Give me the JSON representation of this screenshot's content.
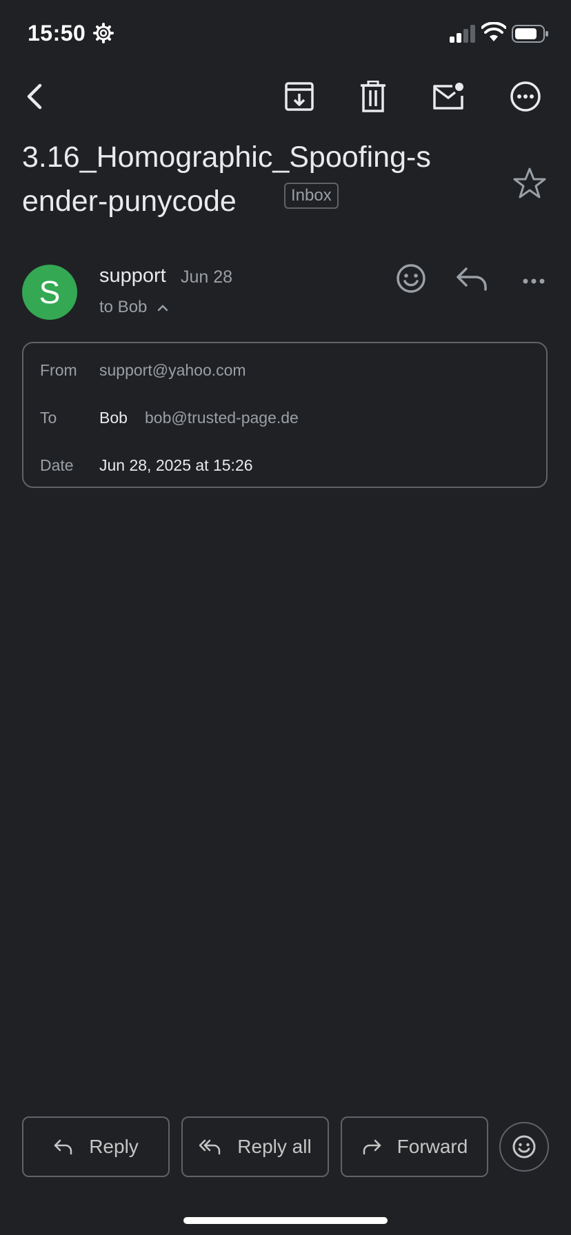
{
  "status_bar": {
    "time": "15:50"
  },
  "toolbar": {
    "back_icon": "back-arrow-icon",
    "archive_icon": "archive-icon",
    "delete_icon": "trash-icon",
    "mark_unread_icon": "mail-unread-icon",
    "more_icon": "more-circle-icon"
  },
  "email": {
    "subject": "3.16_Homographic_Spoofing-sender-punycode",
    "label": "Inbox",
    "sender": {
      "initial": "S",
      "avatar_color": "#34a853",
      "name": "support",
      "date": "Jun 28",
      "to_line": "to Bob"
    },
    "details": {
      "from_label": "From",
      "from_value": "support@yahoo.com",
      "to_label": "To",
      "to_name": "Bob",
      "to_email": "bob@trusted-page.de",
      "date_label": "Date",
      "date_value": "Jun 28, 2025 at 15:26"
    }
  },
  "actions": {
    "reply": "Reply",
    "reply_all": "Reply all",
    "forward": "Forward"
  }
}
